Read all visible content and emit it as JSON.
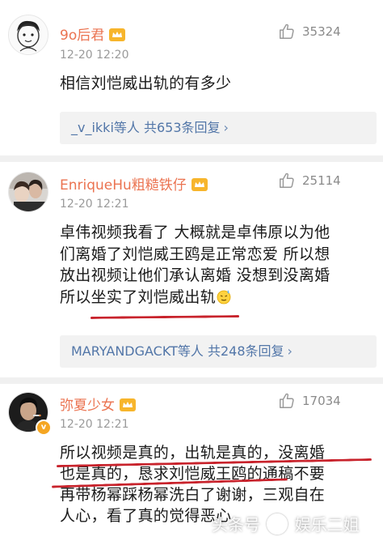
{
  "comments": [
    {
      "username": "9o后君",
      "time": "12-20 12:20",
      "likes": "35324",
      "lines": [
        "相信刘恺威出轨的有多少"
      ],
      "replies": "_v_ikki等人 共653条回复"
    },
    {
      "username": "EnriqueHu粗糙铁仔",
      "time": "12-20 12:21",
      "likes": "25114",
      "lines": [
        "卓伟视频我看了 大概就是卓伟原以为他",
        "们离婚了刘恺威王鸥是正常恋爱 所以想",
        "放出视频让他们承认离婚 没想到没离婚",
        "所以坐实了刘恺威出轨"
      ],
      "replies": "MARYANDGACKT等人 共248条回复"
    },
    {
      "username": "弥夏少女",
      "time": "12-20 12:21",
      "likes": "17034",
      "lines": [
        "所以视频是真的，出轨是真的，没离婚",
        "也是真的，恳求刘恺威王鸥的通稿不要",
        "再带杨幂踩杨幂洗白了谢谢，三观自在",
        "人心，看了真的觉得恶心"
      ]
    }
  ],
  "watermark": {
    "left": "头条号",
    "right": "娱乐二姐"
  },
  "colors": {
    "username": "#eb7350",
    "link": "#5276a8",
    "underline": "#c8232c",
    "badge": "#f5a623"
  },
  "icons": [
    "thumbs-up-icon",
    "vip-crown-icon",
    "chevron-right-icon",
    "verified-badge-icon",
    "sweat-emoji-icon"
  ]
}
